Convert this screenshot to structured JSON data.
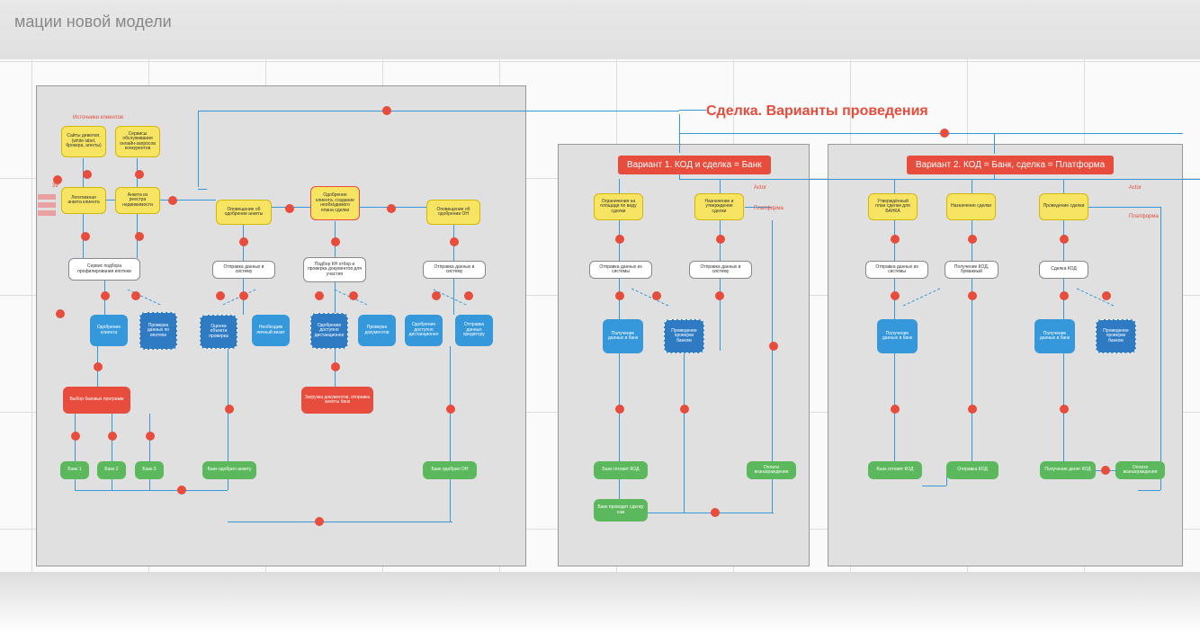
{
  "title_fragment": "мации новой модели",
  "section_title": "Сделка. Варианты проведения",
  "banner1": "Вариант 1. КОД и сделка = Банк",
  "banner2": "Вариант 2. КОД = Банк, сделка = Платформа",
  "source_label": "Источники клиентов",
  "labels": {
    "l1": "39",
    "actor1": "Actor",
    "platform": "Платформа"
  },
  "yellow_nodes": {
    "y1": "Сайты девелоп. (white label, брокера, агенты)",
    "y2": "Сервисы обслуживания онлайн-запросов конкурентов",
    "y3": "Легитимная анкета клиента",
    "y4": "Анкета из реестра недвижимости",
    "y5": "Оповещение об одобрении анкеты",
    "y6": "Одобрение клиента, создание необходимого плана сделки",
    "y7": "Оповещение об одобрении ОН",
    "y8": "Ограничения на площади по виду сделки",
    "y9": "Назначение и утверждение сделки",
    "y10": "Утверждённый план сделки для БАНКА",
    "y11": "Назначение сделки",
    "y12": "Проведение сделки"
  },
  "white_nodes": {
    "w1": "Сервис подбора профилирования ипотеки",
    "w2": "Отправка данных в систему",
    "w3": "Подбор КН отбор и проверка документов для участия",
    "w4": "Отправка данных в систему",
    "w5": "Отправка данных из системы",
    "w6": "Отправка данных в систему",
    "w7": "Отправка данных из системы",
    "w8": "Получение КОД, бумажный",
    "w9": "Сделка КОД"
  },
  "blue_nodes": {
    "b1": "Одобрение клиента",
    "b2": "Проверка данных по ипотеке",
    "b3": "Оценка объекта проверка",
    "b4": "Необходим личный визит",
    "b5": "Одобрение доступно дистанционно",
    "b6": "Проверка документов",
    "b7": "Одобрение доступно дистанционно",
    "b8": "Отправка данных кредитору",
    "b9": "Получение данных в банк",
    "b10": "Проведение проверки банком",
    "b11": "Получение данных в банк",
    "b12": "Получение данных в банк",
    "b13": "Проведение проверки банком"
  },
  "red_nodes": {
    "r1": "Выбор базовых программ",
    "r2": "Загрузка документов, отправка анкеты банк"
  },
  "green_nodes": {
    "g1": "Банк 1",
    "g2": "Банк 2",
    "g3": "Банк 3",
    "g4": "Банк одобрил анкету",
    "g5": "Банк одобрил ОН",
    "g6": "Банк готовит КОД",
    "g7": "Банк проводит сделку сам",
    "g8": "Оплата вознаграждения",
    "g9": "Банк готовит КОД",
    "g10": "Отправка КОД",
    "g11": "Получение денег КОД",
    "g12": "Оплата вознаграждения"
  }
}
